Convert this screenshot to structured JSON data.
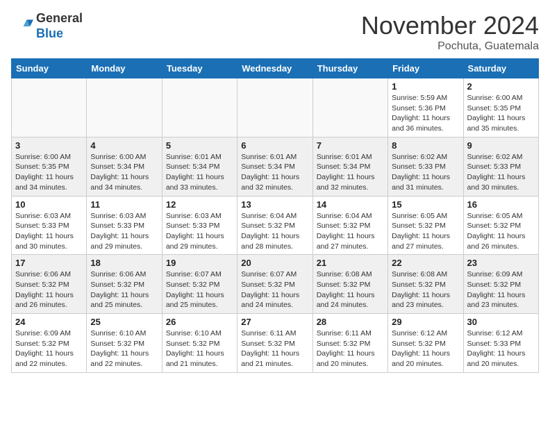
{
  "header": {
    "logo_general": "General",
    "logo_blue": "Blue",
    "month_title": "November 2024",
    "location": "Pochuta, Guatemala"
  },
  "days_of_week": [
    "Sunday",
    "Monday",
    "Tuesday",
    "Wednesday",
    "Thursday",
    "Friday",
    "Saturday"
  ],
  "weeks": [
    [
      {
        "day": "",
        "info": ""
      },
      {
        "day": "",
        "info": ""
      },
      {
        "day": "",
        "info": ""
      },
      {
        "day": "",
        "info": ""
      },
      {
        "day": "",
        "info": ""
      },
      {
        "day": "1",
        "info": "Sunrise: 5:59 AM\nSunset: 5:36 PM\nDaylight: 11 hours\nand 36 minutes."
      },
      {
        "day": "2",
        "info": "Sunrise: 6:00 AM\nSunset: 5:35 PM\nDaylight: 11 hours\nand 35 minutes."
      }
    ],
    [
      {
        "day": "3",
        "info": "Sunrise: 6:00 AM\nSunset: 5:35 PM\nDaylight: 11 hours\nand 34 minutes."
      },
      {
        "day": "4",
        "info": "Sunrise: 6:00 AM\nSunset: 5:34 PM\nDaylight: 11 hours\nand 34 minutes."
      },
      {
        "day": "5",
        "info": "Sunrise: 6:01 AM\nSunset: 5:34 PM\nDaylight: 11 hours\nand 33 minutes."
      },
      {
        "day": "6",
        "info": "Sunrise: 6:01 AM\nSunset: 5:34 PM\nDaylight: 11 hours\nand 32 minutes."
      },
      {
        "day": "7",
        "info": "Sunrise: 6:01 AM\nSunset: 5:34 PM\nDaylight: 11 hours\nand 32 minutes."
      },
      {
        "day": "8",
        "info": "Sunrise: 6:02 AM\nSunset: 5:33 PM\nDaylight: 11 hours\nand 31 minutes."
      },
      {
        "day": "9",
        "info": "Sunrise: 6:02 AM\nSunset: 5:33 PM\nDaylight: 11 hours\nand 30 minutes."
      }
    ],
    [
      {
        "day": "10",
        "info": "Sunrise: 6:03 AM\nSunset: 5:33 PM\nDaylight: 11 hours\nand 30 minutes."
      },
      {
        "day": "11",
        "info": "Sunrise: 6:03 AM\nSunset: 5:33 PM\nDaylight: 11 hours\nand 29 minutes."
      },
      {
        "day": "12",
        "info": "Sunrise: 6:03 AM\nSunset: 5:33 PM\nDaylight: 11 hours\nand 29 minutes."
      },
      {
        "day": "13",
        "info": "Sunrise: 6:04 AM\nSunset: 5:32 PM\nDaylight: 11 hours\nand 28 minutes."
      },
      {
        "day": "14",
        "info": "Sunrise: 6:04 AM\nSunset: 5:32 PM\nDaylight: 11 hours\nand 27 minutes."
      },
      {
        "day": "15",
        "info": "Sunrise: 6:05 AM\nSunset: 5:32 PM\nDaylight: 11 hours\nand 27 minutes."
      },
      {
        "day": "16",
        "info": "Sunrise: 6:05 AM\nSunset: 5:32 PM\nDaylight: 11 hours\nand 26 minutes."
      }
    ],
    [
      {
        "day": "17",
        "info": "Sunrise: 6:06 AM\nSunset: 5:32 PM\nDaylight: 11 hours\nand 26 minutes."
      },
      {
        "day": "18",
        "info": "Sunrise: 6:06 AM\nSunset: 5:32 PM\nDaylight: 11 hours\nand 25 minutes."
      },
      {
        "day": "19",
        "info": "Sunrise: 6:07 AM\nSunset: 5:32 PM\nDaylight: 11 hours\nand 25 minutes."
      },
      {
        "day": "20",
        "info": "Sunrise: 6:07 AM\nSunset: 5:32 PM\nDaylight: 11 hours\nand 24 minutes."
      },
      {
        "day": "21",
        "info": "Sunrise: 6:08 AM\nSunset: 5:32 PM\nDaylight: 11 hours\nand 24 minutes."
      },
      {
        "day": "22",
        "info": "Sunrise: 6:08 AM\nSunset: 5:32 PM\nDaylight: 11 hours\nand 23 minutes."
      },
      {
        "day": "23",
        "info": "Sunrise: 6:09 AM\nSunset: 5:32 PM\nDaylight: 11 hours\nand 23 minutes."
      }
    ],
    [
      {
        "day": "24",
        "info": "Sunrise: 6:09 AM\nSunset: 5:32 PM\nDaylight: 11 hours\nand 22 minutes."
      },
      {
        "day": "25",
        "info": "Sunrise: 6:10 AM\nSunset: 5:32 PM\nDaylight: 11 hours\nand 22 minutes."
      },
      {
        "day": "26",
        "info": "Sunrise: 6:10 AM\nSunset: 5:32 PM\nDaylight: 11 hours\nand 21 minutes."
      },
      {
        "day": "27",
        "info": "Sunrise: 6:11 AM\nSunset: 5:32 PM\nDaylight: 11 hours\nand 21 minutes."
      },
      {
        "day": "28",
        "info": "Sunrise: 6:11 AM\nSunset: 5:32 PM\nDaylight: 11 hours\nand 20 minutes."
      },
      {
        "day": "29",
        "info": "Sunrise: 6:12 AM\nSunset: 5:32 PM\nDaylight: 11 hours\nand 20 minutes."
      },
      {
        "day": "30",
        "info": "Sunrise: 6:12 AM\nSunset: 5:33 PM\nDaylight: 11 hours\nand 20 minutes."
      }
    ]
  ]
}
